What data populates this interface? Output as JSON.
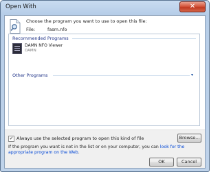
{
  "window": {
    "title": "Open With",
    "close_glyph": "✕"
  },
  "header": {
    "prompt": "Choose the program you want to use to open this file:",
    "file_label": "File:",
    "file_name": "fasm.nfo",
    "icon": "document-search-icon"
  },
  "programs": {
    "recommended_label": "Recommended Programs",
    "items": [
      {
        "name": "DAMN NFO Viewer",
        "vendor": "DAMN",
        "icon": "nfo-viewer-icon"
      }
    ],
    "other_label": "Other Programs",
    "other_chevron": "▾"
  },
  "options": {
    "always_use_label": "Always use the selected program to open this kind of file",
    "always_use_checked": true,
    "check_glyph": "✓"
  },
  "buttons": {
    "browse": "Browse...",
    "ok": "OK",
    "cancel": "Cancel"
  },
  "info": {
    "text_before": "If the program you want is not in the list or on your computer, you can ",
    "link_text": "look for the appropriate program on the Web",
    "text_after": "."
  },
  "colors": {
    "link": "#0046d5",
    "group_header": "#1e3287",
    "close_button": "#c7432a"
  }
}
